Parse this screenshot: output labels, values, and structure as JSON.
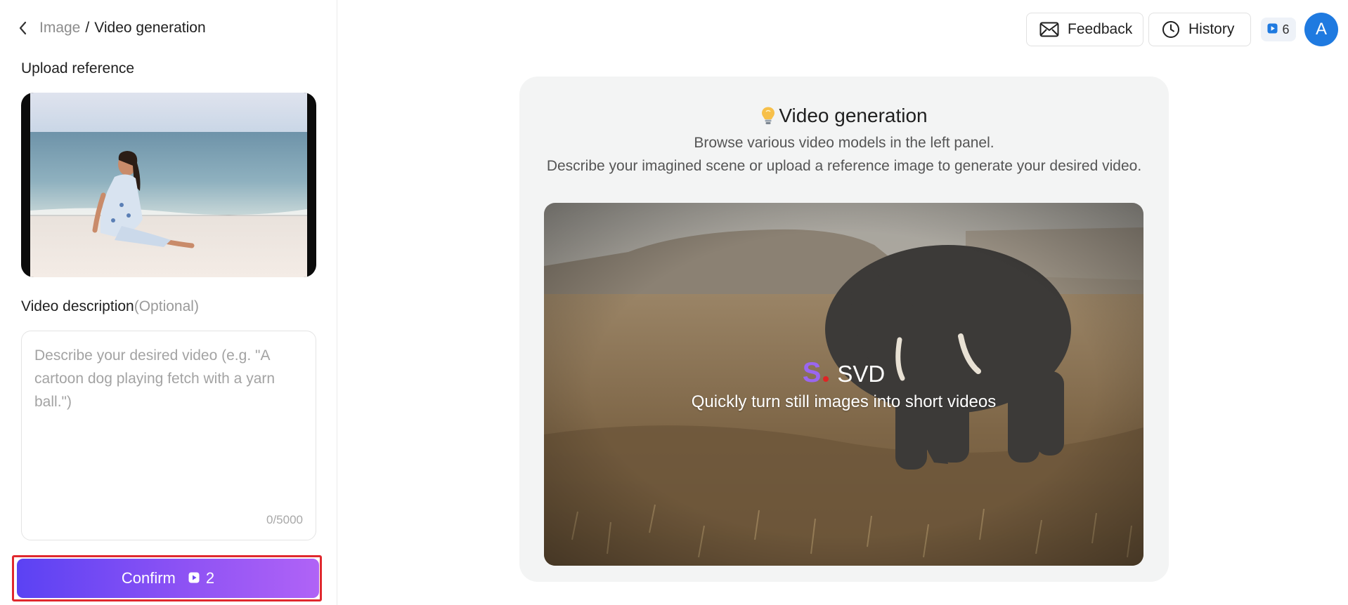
{
  "breadcrumb": {
    "parent": "Image",
    "separator": "/",
    "current": "Video generation"
  },
  "upload": {
    "label": "Upload reference"
  },
  "description": {
    "label": "Video description",
    "optional": "(Optional)",
    "placeholder": "Describe your desired video (e.g. \"A cartoon dog playing fetch with a yarn ball.\")",
    "value": "",
    "char_count": "0/5000"
  },
  "confirm": {
    "label": "Confirm",
    "cost": "2"
  },
  "header": {
    "feedback_label": "Feedback",
    "history_label": "History",
    "credits": "6",
    "avatar_initial": "A"
  },
  "main": {
    "title": "Video generation",
    "subtitle_1": "Browse various video models in the left panel.",
    "subtitle_2": "Describe your imagined scene or upload a reference image to generate your desired video.",
    "model": {
      "logo_letter": "S",
      "name": "SVD",
      "tagline": "Quickly turn still images into short videos"
    }
  },
  "icons": {
    "back": "chevron-left-icon",
    "feedback": "mail-icon",
    "history": "clock-icon",
    "credit": "play-credit-icon",
    "bulb": "lightbulb-icon"
  },
  "colors": {
    "confirm_gradient_start": "#5b42f3",
    "confirm_gradient_end": "#b063f6",
    "highlight_outline": "#e0282e",
    "avatar_bg": "#1f7ae0",
    "svd_logo": "#9a66f0"
  }
}
